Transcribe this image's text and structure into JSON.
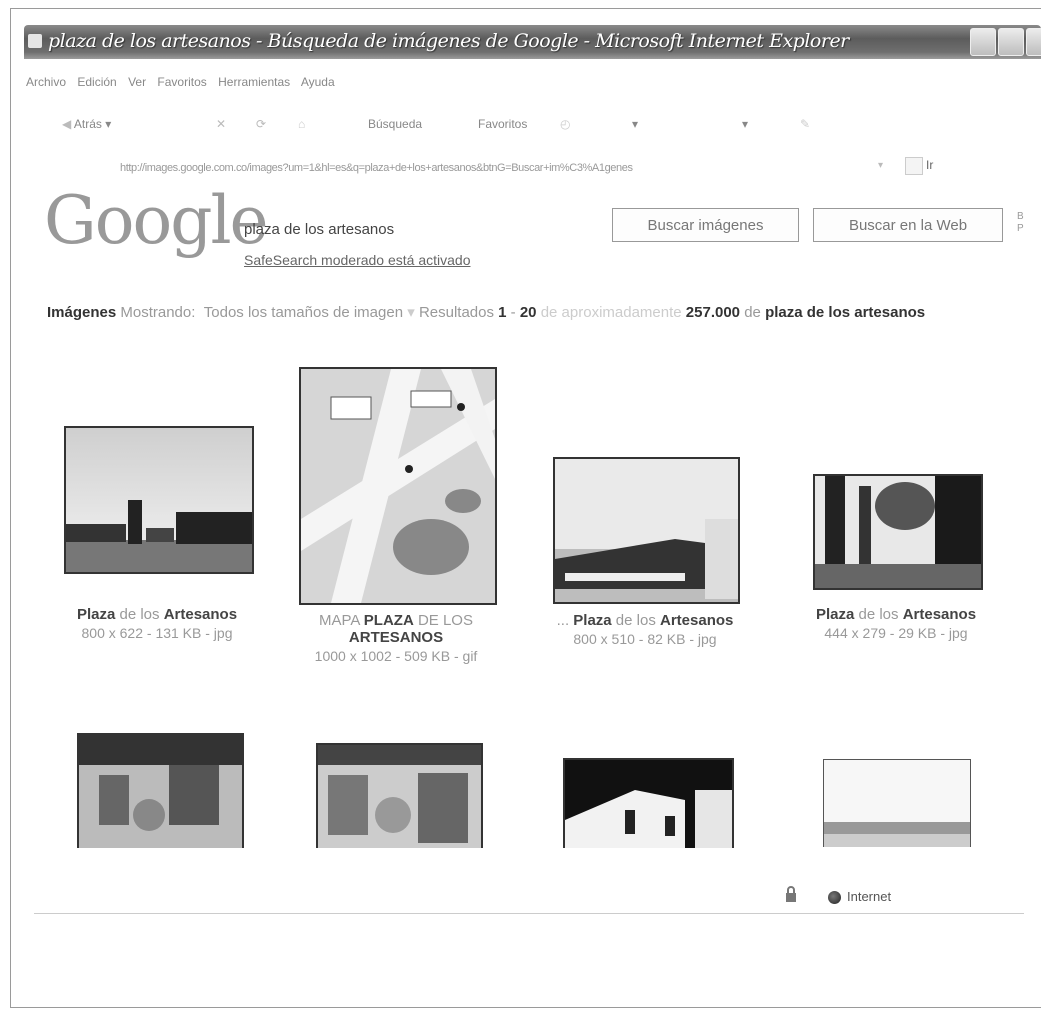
{
  "window": {
    "title": "plaza de los artesanos - Búsqueda de imágenes de Google - Microsoft Internet Explorer"
  },
  "menu": [
    "Archivo",
    "Edición",
    "Ver",
    "Favoritos",
    "Herramientas",
    "Ayuda"
  ],
  "toolbar": {
    "back": "Atrás",
    "search": "Búsqueda",
    "favorites": "Favoritos"
  },
  "address": {
    "url": "http://images.google.com.co/images?um=1&hl=es&q=plaza+de+los+artesanos&btnG=Buscar+im%C3%A1genes",
    "go": "Ir"
  },
  "google": {
    "logo": "Google",
    "query": "plaza de los artesanos",
    "safesearch": "SafeSearch moderado está activado",
    "btn_images": "Buscar imágenes",
    "btn_web": "Buscar en la Web"
  },
  "results_bar": {
    "label": "Imágenes",
    "showing": "Mostrando:",
    "sizes": "Todos los tamaños de imagen",
    "results_prefix": "Resultados",
    "range_start": "1",
    "range_sep": "-",
    "range_end": "20",
    "approx": "de aproximadamente",
    "count": "257.000",
    "de": "de",
    "query": "plaza de los artesanos"
  },
  "results": [
    {
      "title_pre": "",
      "title_a": "Plaza",
      "title_mid": " de los ",
      "title_b": "Artesanos",
      "dims": "800 x 622 - 131 KB - jpg"
    },
    {
      "title_pre": "MAPA ",
      "title_a": "PLAZA",
      "title_mid": " DE LOS",
      "title_b": "ARTESANOS",
      "dims": "1000 x 1002 - 509 KB - gif"
    },
    {
      "title_pre": "... ",
      "title_a": "Plaza",
      "title_mid": " de los ",
      "title_b": "Artesanos",
      "dims": "800 x 510 - 82 KB - jpg"
    },
    {
      "title_pre": "",
      "title_a": "Plaza",
      "title_mid": " de los ",
      "title_b": "Artesanos",
      "dims": "444 x 279 - 29 KB - jpg"
    }
  ],
  "status": {
    "zone": "Internet"
  }
}
